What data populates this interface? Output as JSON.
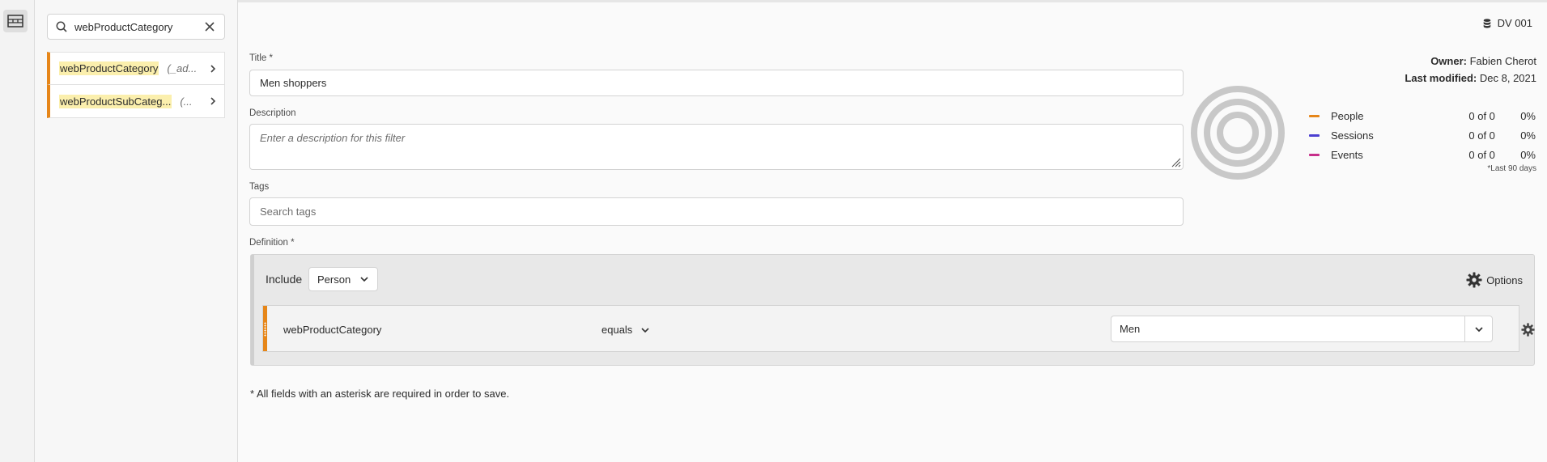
{
  "rail": {
    "icon": "segments-icon"
  },
  "panel": {
    "search": {
      "value": "webProductCategory",
      "icon": "search-icon"
    },
    "items": [
      {
        "match": "webProductCategory",
        "rest": "",
        "hint": "(_ad...",
        "accent": "#e68619"
      },
      {
        "match": "webProduct",
        "rest": "SubCateg...",
        "hint": "(...",
        "accent": "#e68619"
      }
    ]
  },
  "header": {
    "dataview": "DV 001"
  },
  "owner": {
    "owner_label": "Owner:",
    "owner_value": "Fabien Cherot",
    "modified_label": "Last modified:",
    "modified_value": "Dec 8, 2021"
  },
  "form": {
    "title_label": "Title *",
    "title_value": "Men shoppers",
    "description_label": "Description",
    "description_placeholder": "Enter a description for this filter",
    "tags_label": "Tags",
    "tags_placeholder": "Search tags",
    "definition_label": "Definition *"
  },
  "stats": {
    "rows": [
      {
        "label": "People",
        "count": "0 of 0",
        "pct": "0%",
        "color": "#e68619"
      },
      {
        "label": "Sessions",
        "count": "0 of 0",
        "pct": "0%",
        "color": "#4b3fd1"
      },
      {
        "label": "Events",
        "count": "0 of 0",
        "pct": "0%",
        "color": "#c72e8a"
      }
    ],
    "footnote": "*Last 90 days"
  },
  "definition": {
    "include_label": "Include",
    "scope": "Person",
    "options_label": "Options",
    "rule": {
      "dimension": "webProductCategory",
      "operator": "equals",
      "value": "Men"
    }
  },
  "footer": {
    "required_note": "* All fields with an asterisk are required in order to save."
  }
}
